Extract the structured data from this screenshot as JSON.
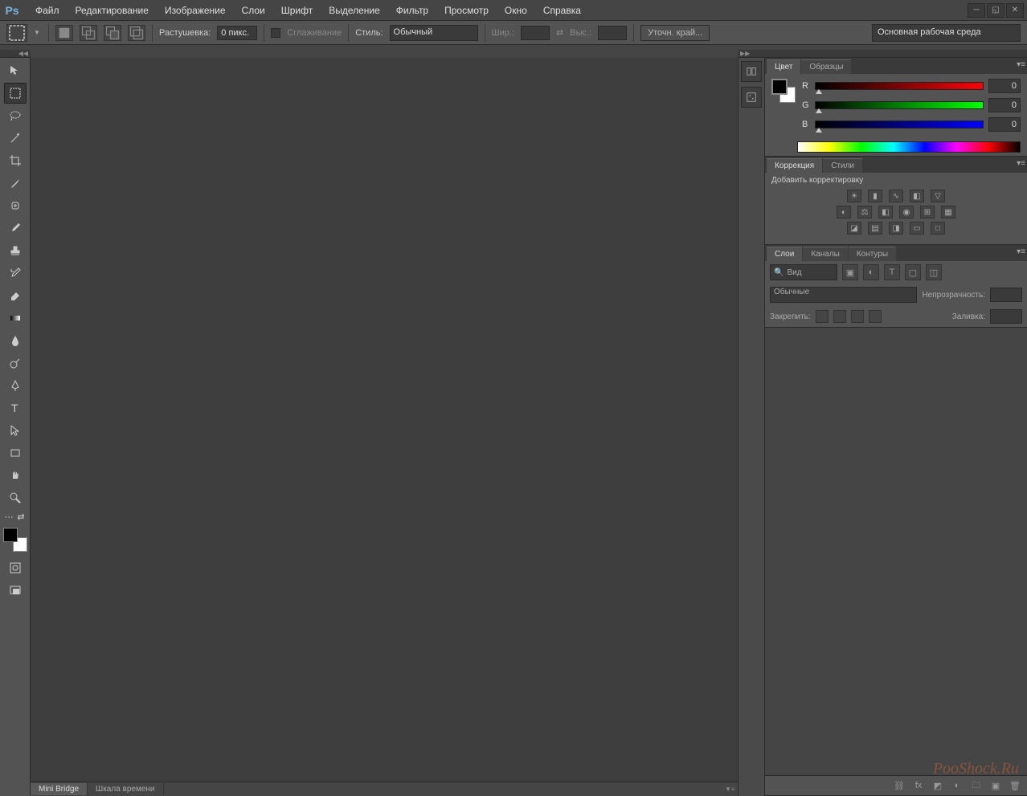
{
  "app_logo": "Ps",
  "menu": [
    "Файл",
    "Редактирование",
    "Изображение",
    "Слои",
    "Шрифт",
    "Выделение",
    "Фильтр",
    "Просмотр",
    "Окно",
    "Справка"
  ],
  "options": {
    "feather_label": "Растушевка:",
    "feather_value": "0 пикс.",
    "antialias_label": "Сглаживание",
    "style_label": "Стиль:",
    "style_value": "Обычный",
    "width_label": "Шир.:",
    "width_value": "",
    "height_label": "Выс.:",
    "height_value": "",
    "refine_label": "Уточн. край...",
    "workspace": "Основная рабочая среда"
  },
  "colors": {
    "fg": "#000000",
    "bg": "#ffffff"
  },
  "color_panel": {
    "tab1": "Цвет",
    "tab2": "Образцы",
    "r_label": "R",
    "r_value": "0",
    "g_label": "G",
    "g_value": "0",
    "b_label": "B",
    "b_value": "0"
  },
  "adjust_panel": {
    "tab1": "Коррекция",
    "tab2": "Стили",
    "title": "Добавить корректировку"
  },
  "layers_panel": {
    "tab1": "Слои",
    "tab2": "Каналы",
    "tab3": "Контуры",
    "kind_label": "Вид",
    "blend_mode": "Обычные",
    "opacity_label": "Непрозрачность:",
    "lock_label": "Закрепить:",
    "fill_label": "Заливка:"
  },
  "bottom": {
    "tab1": "Mini Bridge",
    "tab2": "Шкала времени"
  },
  "watermark": "PooShock.Ru"
}
